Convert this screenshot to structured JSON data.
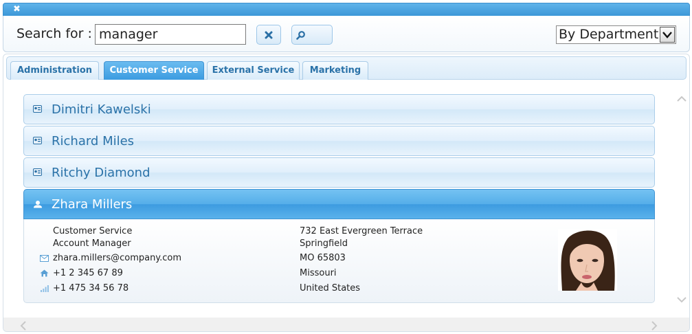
{
  "window": {
    "close_symbol": "✖"
  },
  "search": {
    "label": "Search for :",
    "value": "manager",
    "clear_icon": "close-icon",
    "find_icon": "search-icon"
  },
  "filter": {
    "selected": "By Department"
  },
  "tabs": [
    {
      "label": "Administration",
      "active": false
    },
    {
      "label": "Customer Service",
      "active": true
    },
    {
      "label": "External Service",
      "active": false
    },
    {
      "label": "Marketing",
      "active": false
    }
  ],
  "contacts": [
    {
      "name": "Dimitri Kawelski",
      "expanded": false,
      "icon": "contact-card-icon"
    },
    {
      "name": "Richard Miles",
      "expanded": false,
      "icon": "contact-card-icon"
    },
    {
      "name": "Ritchy Diamond",
      "expanded": false,
      "icon": "contact-card-icon"
    },
    {
      "name": "Zhara Millers",
      "expanded": true,
      "icon": "user-icon"
    }
  ],
  "details": {
    "department": "Customer Service",
    "title": "Account Manager",
    "email": "zhara.millers@company.com",
    "home_phone": "+1 2 345 67 89",
    "mobile_phone": "+1 475 34 56 78",
    "address": "732 East Evergreen Terrace",
    "city": "Springfield",
    "zip": "MO 65803",
    "state": "Missouri",
    "country": "United States"
  },
  "colors": {
    "accent": "#3d9be0",
    "text_link": "#2a72a8"
  }
}
